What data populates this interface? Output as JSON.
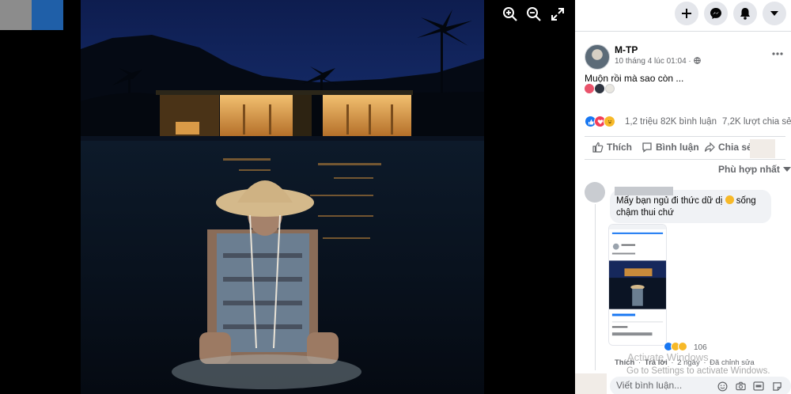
{
  "viewer": {
    "icons": [
      "zoom-in-icon",
      "zoom-out-icon",
      "fullscreen-icon"
    ]
  },
  "topbar": {
    "icons": [
      "plus-icon",
      "messenger-icon",
      "notifications-bell-icon",
      "caret-down-icon"
    ]
  },
  "post": {
    "author": "M-TP",
    "time": "10 tháng 4 lúc 01:04 · ",
    "caption": "Muộn rồi mà sao còn ...",
    "caption_emoji_colors": [
      "#e9536b",
      "#2e3440",
      "#e8e6e0"
    ],
    "reactions": {
      "count": "1,2 triệu",
      "comments": "82K bình luận",
      "shares": "7,2K lượt chia sẻ",
      "colors": [
        "#1877f2",
        "#f33e58",
        "#f7b928"
      ]
    },
    "actions": {
      "like": "Thích",
      "comment": "Bình luận",
      "share": "Chia sẻ"
    },
    "sort_label": "Phù hợp nhất"
  },
  "comment": {
    "text": "Mấy bạn ngủ đi thức dữ dị",
    "text_tail": " sống chậm thui chứ",
    "react_count": "106",
    "like_label": "Thích",
    "reply_label": "Trả lời",
    "age": "2 ngày",
    "edited": "Đã chỉnh sửa"
  },
  "watermark": {
    "title": "Activate Windows",
    "subtitle": "Go to Settings to activate Windows."
  },
  "composer": {
    "placeholder": "Viết bình luận..."
  },
  "accent": "#1877f2"
}
